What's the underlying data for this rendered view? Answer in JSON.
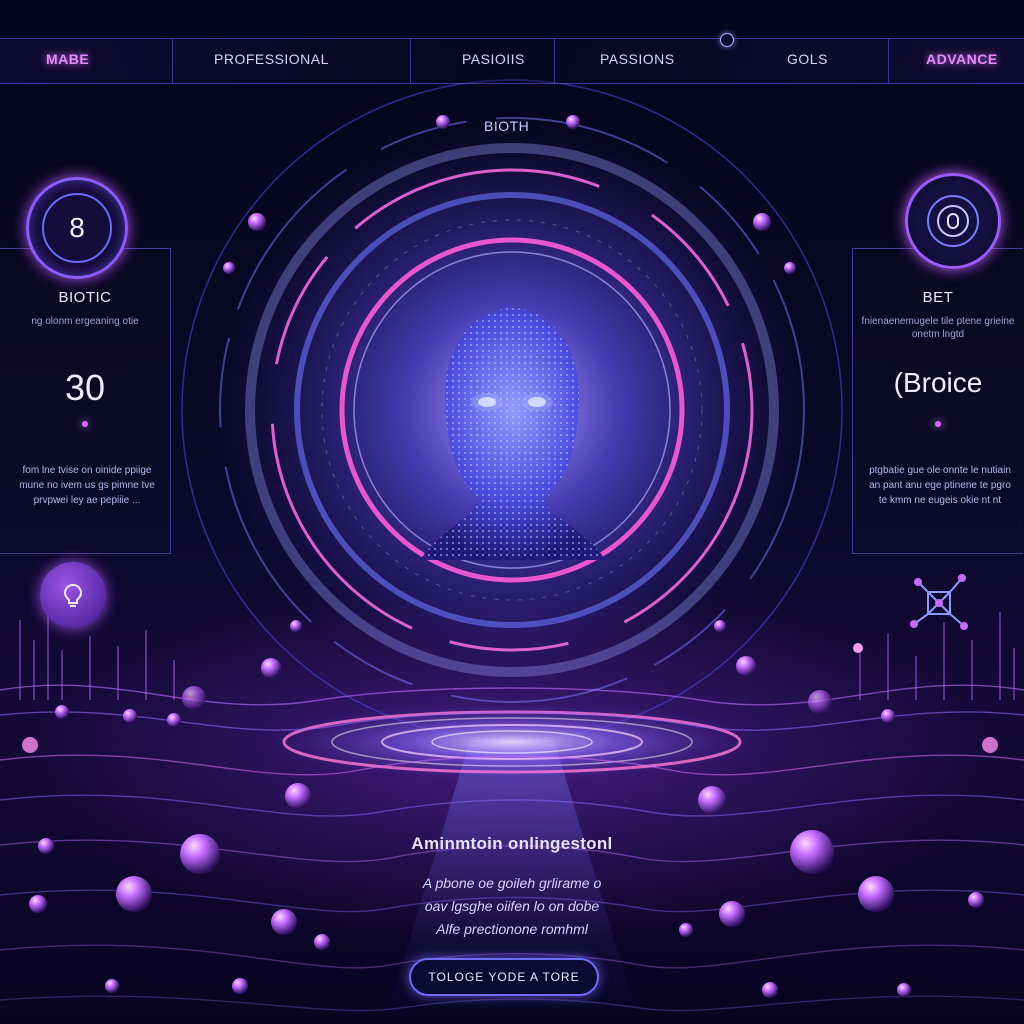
{
  "nav": {
    "items": [
      {
        "label": "MABE"
      },
      {
        "label": "PROFESSIONAL"
      },
      {
        "label": "PASIOIIS"
      },
      {
        "label": "PASSIONS"
      },
      {
        "label": "GOLS"
      },
      {
        "label": "ADVANCE"
      }
    ]
  },
  "hero": {
    "label": "BIOTH"
  },
  "left_panel": {
    "badge_value": "8",
    "title": "BIOTIC",
    "subtitle": "ng olonm ergeaning otie",
    "big_value": "30",
    "body": "fom lne tvise on oinide ppiige mune no ivem us gs pimne tve prvpwei ley ae pepiiie ..."
  },
  "right_panel": {
    "title": "BET",
    "subtitle": "fnienaenemugele tile ptene grieine onetm lngtd",
    "big_value": "(Broice",
    "body": "ptgbatie gue ole onnte le nutiain an pant anu ege ptinene te pgro te kmm ne eugeis okie nt nt"
  },
  "cta": {
    "heading": "Aminmtoin onlingestonl",
    "line1": "A pbone oe goileh grlirame o",
    "line2": "oav lgsghe oiifen lo on dobe",
    "line3": "Alfe prectionone romhml",
    "button_label": "TOLOGE YODE A TORE"
  },
  "colors": {
    "background": "#050418",
    "accent_purple": "#b55cff",
    "accent_blue": "#5a6cff",
    "accent_pink": "#ff5cd6",
    "text_light": "#e8e2ff"
  },
  "icons": {
    "counter_badge": "ring-counter-icon",
    "target_badge": "target-icon",
    "bulb_badge": "lightbulb-icon",
    "network": "network-nodes-icon"
  }
}
